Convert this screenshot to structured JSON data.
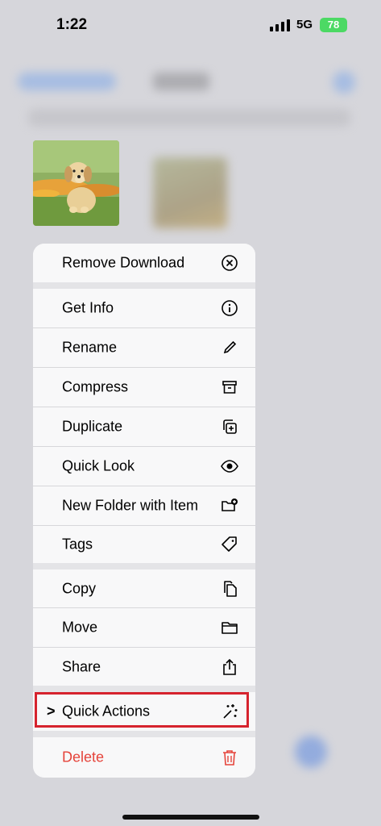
{
  "status_bar": {
    "time": "1:22",
    "network": "5G",
    "battery": "78"
  },
  "menu": {
    "remove_download": {
      "label": "Remove Download",
      "icon": "circle-x-icon"
    },
    "group2": [
      {
        "label": "Get Info",
        "icon": "info-icon"
      },
      {
        "label": "Rename",
        "icon": "pencil-icon"
      },
      {
        "label": "Compress",
        "icon": "archive-box-icon"
      },
      {
        "label": "Duplicate",
        "icon": "duplicate-icon"
      },
      {
        "label": "Quick Look",
        "icon": "eye-icon"
      },
      {
        "label": "New Folder with Item",
        "icon": "folder-plus-icon"
      },
      {
        "label": "Tags",
        "icon": "tag-icon"
      }
    ],
    "group3": [
      {
        "label": "Copy",
        "icon": "copy-icon"
      },
      {
        "label": "Move",
        "icon": "folder-icon"
      },
      {
        "label": "Share",
        "icon": "share-icon"
      }
    ],
    "quick_actions": {
      "label": "Quick Actions",
      "chevron": ">",
      "icon": "sparkles-icon"
    },
    "delete": {
      "label": "Delete",
      "icon": "trash-icon",
      "color": "#e5433a"
    }
  },
  "highlight_color": "#d6232e"
}
